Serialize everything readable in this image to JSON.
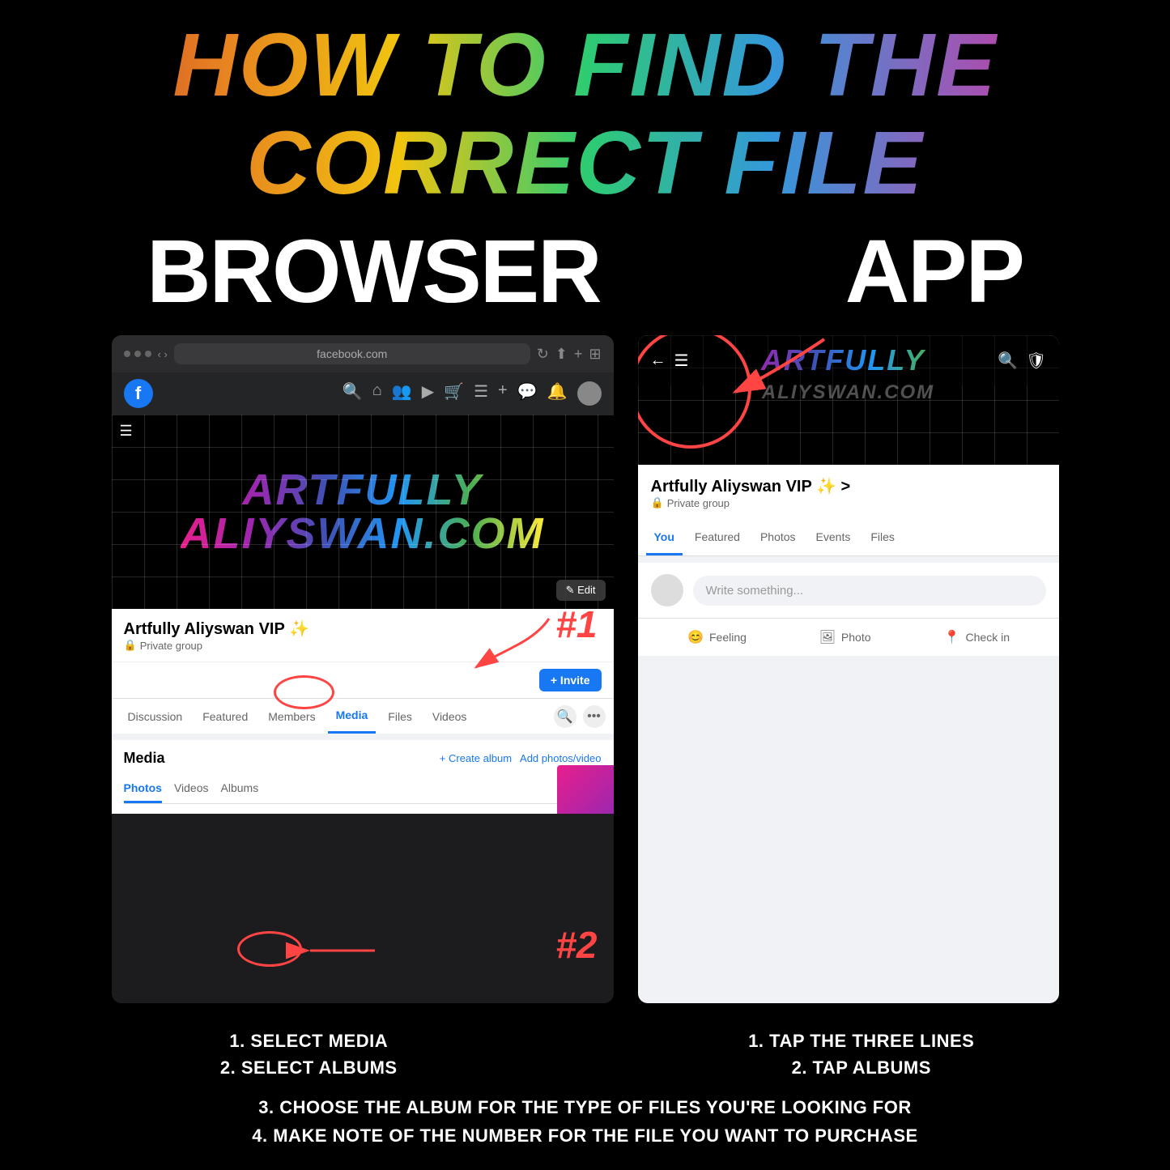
{
  "title": {
    "line1": "HOW TO FIND THE CORRECT FILE",
    "browser_label": "BROWSER",
    "app_label": "APP"
  },
  "browser": {
    "url": "facebook.com",
    "group_name": "Artfully Aliyswan VIP ✨",
    "private_label": "Private group",
    "tabs": [
      "Discussion",
      "Featured",
      "Members",
      "Media",
      "Files",
      "Videos"
    ],
    "active_tab": "Media",
    "edit_btn": "✎ Edit",
    "invite_btn": "+ Invite",
    "media_title": "Media",
    "create_album": "+ Create album",
    "add_photos": "Add photos/video",
    "sub_tabs": [
      "Photos",
      "Videos",
      "Albums"
    ],
    "active_sub_tab": "Albums",
    "annotation1": "#1",
    "annotation2": "#2"
  },
  "app": {
    "group_name": "Artfully Aliyswan VIP ✨ >",
    "private_label": "Private group",
    "tabs": [
      "You",
      "Featured",
      "Photos",
      "Events",
      "Files"
    ],
    "active_tab": "You",
    "write_placeholder": "Write something...",
    "actions": [
      {
        "label": "Feeling",
        "icon": "😊",
        "color": "#f0b429"
      },
      {
        "label": "Photo",
        "icon": "🖼",
        "color": "#36c759"
      },
      {
        "label": "Check in",
        "icon": "📍",
        "color": "#ff6b6b"
      }
    ]
  },
  "instructions": {
    "browser": {
      "lines": [
        "1. SELECT MEDIA",
        "2. SELECT ALBUMS"
      ]
    },
    "app": {
      "lines": [
        "1. TAP THE THREE LINES",
        "2. TAP ALBUMS"
      ]
    },
    "bottom": [
      "3. CHOOSE THE ALBUM FOR THE TYPE OF FILES YOU'RE LOOKING FOR",
      "4. MAKE NOTE OF THE NUMBER FOR THE FILE YOU WANT TO PURCHASE"
    ]
  }
}
